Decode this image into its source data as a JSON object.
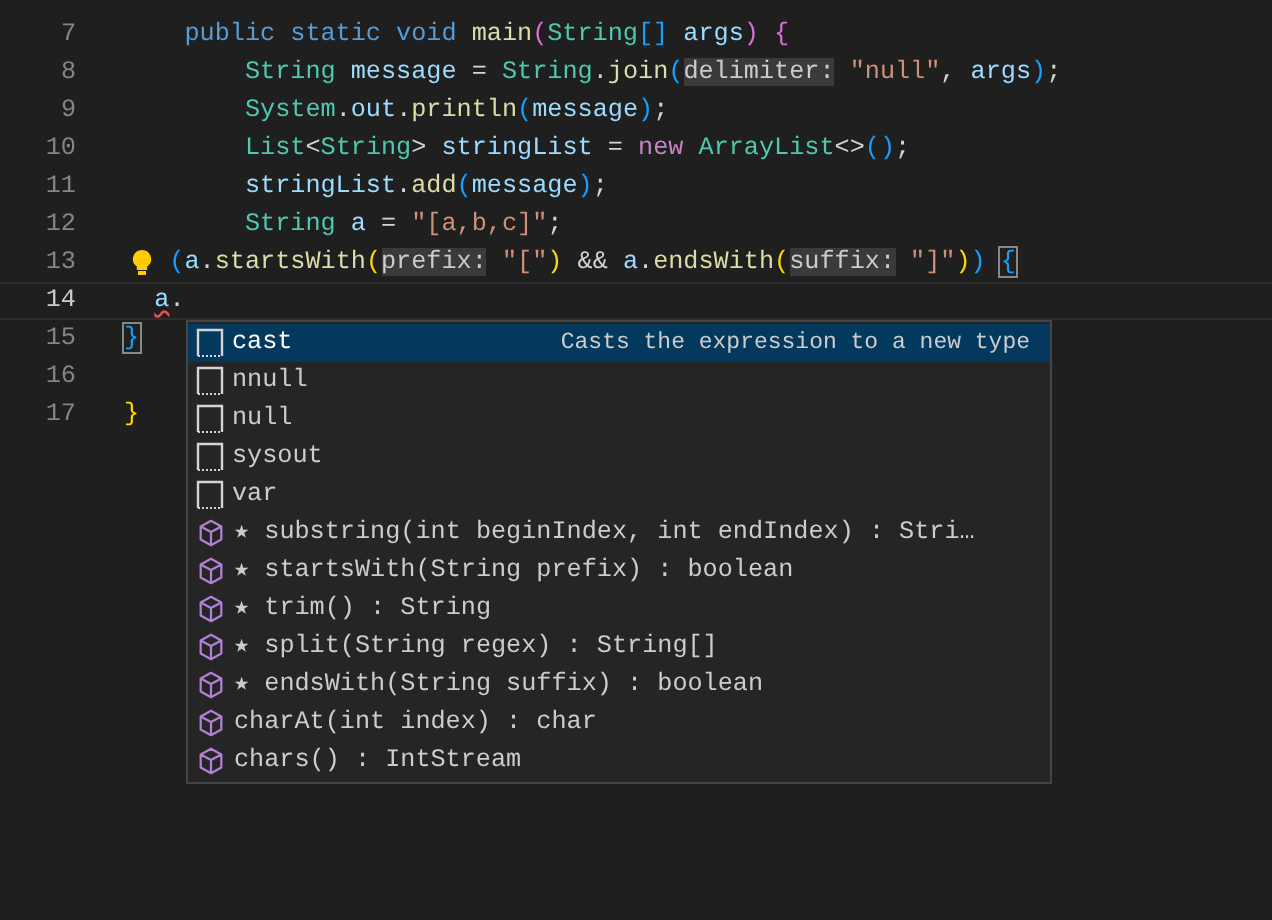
{
  "editor": {
    "lines": [
      {
        "number": "7",
        "active": false,
        "lightbulb": false,
        "tokens": [
          {
            "text": "    public static void",
            "kind": "keyword"
          },
          {
            "text": " main",
            "kind": "function"
          },
          {
            "text": "(",
            "kind": "bracket2"
          },
          {
            "text": "String",
            "kind": "type"
          },
          {
            "text": "[]",
            "kind": "bracket3"
          },
          {
            "text": " args",
            "kind": "variable"
          },
          {
            "text": ")",
            "kind": "bracket2"
          },
          {
            "text": " {",
            "kind": "bracket2"
          }
        ]
      },
      {
        "number": "8",
        "active": false,
        "lightbulb": false,
        "tokens": [
          {
            "text": "        String",
            "kind": "type"
          },
          {
            "text": " message",
            "kind": "variable"
          },
          {
            "text": " = ",
            "kind": "plain"
          },
          {
            "text": "String",
            "kind": "type"
          },
          {
            "text": ".",
            "kind": "plain"
          },
          {
            "text": "join",
            "kind": "function"
          },
          {
            "text": "(",
            "kind": "bracket3"
          },
          {
            "text": "delimiter:",
            "kind": "hint"
          },
          {
            "text": " \"null\"",
            "kind": "string"
          },
          {
            "text": ", ",
            "kind": "plain"
          },
          {
            "text": "args",
            "kind": "variable"
          },
          {
            "text": ")",
            "kind": "bracket3"
          },
          {
            "text": ";",
            "kind": "plain"
          }
        ]
      },
      {
        "number": "9",
        "active": false,
        "lightbulb": false,
        "tokens": [
          {
            "text": "        System",
            "kind": "type"
          },
          {
            "text": ".",
            "kind": "plain"
          },
          {
            "text": "out",
            "kind": "variable"
          },
          {
            "text": ".",
            "kind": "plain"
          },
          {
            "text": "println",
            "kind": "function"
          },
          {
            "text": "(",
            "kind": "bracket3"
          },
          {
            "text": "message",
            "kind": "variable"
          },
          {
            "text": ")",
            "kind": "bracket3"
          },
          {
            "text": ";",
            "kind": "plain"
          }
        ]
      },
      {
        "number": "10",
        "active": false,
        "lightbulb": false,
        "tokens": [
          {
            "text": "        List",
            "kind": "type"
          },
          {
            "text": "<",
            "kind": "plain"
          },
          {
            "text": "String",
            "kind": "type"
          },
          {
            "text": ">",
            "kind": "plain"
          },
          {
            "text": " stringList",
            "kind": "variable"
          },
          {
            "text": " = ",
            "kind": "plain"
          },
          {
            "text": "new",
            "kind": "control"
          },
          {
            "text": " ArrayList",
            "kind": "type"
          },
          {
            "text": "<>",
            "kind": "plain"
          },
          {
            "text": "()",
            "kind": "bracket3"
          },
          {
            "text": ";",
            "kind": "plain"
          }
        ]
      },
      {
        "number": "11",
        "active": false,
        "lightbulb": false,
        "tokens": [
          {
            "text": "        stringList",
            "kind": "variable"
          },
          {
            "text": ".",
            "kind": "plain"
          },
          {
            "text": "add",
            "kind": "function"
          },
          {
            "text": "(",
            "kind": "bracket3"
          },
          {
            "text": "message",
            "kind": "variable"
          },
          {
            "text": ")",
            "kind": "bracket3"
          },
          {
            "text": ";",
            "kind": "plain"
          }
        ]
      },
      {
        "number": "12",
        "active": false,
        "lightbulb": false,
        "tokens": [
          {
            "text": "        String",
            "kind": "type"
          },
          {
            "text": " a",
            "kind": "variable"
          },
          {
            "text": " = ",
            "kind": "plain"
          },
          {
            "text": "\"[a,b,c]\"",
            "kind": "string"
          },
          {
            "text": ";",
            "kind": "plain"
          }
        ]
      },
      {
        "number": "13",
        "active": false,
        "lightbulb": true,
        "tokens": [
          {
            "text": "   (",
            "kind": "bracket3"
          },
          {
            "text": "a",
            "kind": "variable"
          },
          {
            "text": ".",
            "kind": "plain"
          },
          {
            "text": "startsWith",
            "kind": "function"
          },
          {
            "text": "(",
            "kind": "bracket1"
          },
          {
            "text": "prefix:",
            "kind": "hint"
          },
          {
            "text": " \"[\"",
            "kind": "string"
          },
          {
            "text": ")",
            "kind": "bracket1"
          },
          {
            "text": " && ",
            "kind": "plain"
          },
          {
            "text": "a",
            "kind": "variable"
          },
          {
            "text": ".",
            "kind": "plain"
          },
          {
            "text": "endsWith",
            "kind": "function"
          },
          {
            "text": "(",
            "kind": "bracket1"
          },
          {
            "text": "suffix:",
            "kind": "hint"
          },
          {
            "text": " \"]\"",
            "kind": "string"
          },
          {
            "text": ")",
            "kind": "bracket1"
          },
          {
            "text": ") ",
            "kind": "bracket3"
          },
          {
            "text": "{",
            "kind": "match"
          }
        ]
      },
      {
        "number": "14",
        "active": true,
        "lightbulb": false,
        "tokens": [
          {
            "text": "  a",
            "kind": "error"
          },
          {
            "text": ".",
            "kind": "plain"
          }
        ]
      },
      {
        "number": "15",
        "active": false,
        "lightbulb": false,
        "tokens": [
          {
            "text": "}",
            "kind": "match"
          }
        ]
      },
      {
        "number": "16",
        "active": false,
        "lightbulb": false
      },
      {
        "number": "17",
        "active": false,
        "lightbulb": false,
        "tokens": [
          {
            "text": "}",
            "kind": "bracket1"
          }
        ]
      }
    ]
  },
  "suggestions": [
    {
      "kind": "snippet",
      "label": "cast",
      "detail": "Casts the expression to a new type",
      "selected": true
    },
    {
      "kind": "snippet",
      "label": "nnull",
      "selected": false
    },
    {
      "kind": "snippet",
      "label": "null",
      "selected": false
    },
    {
      "kind": "snippet",
      "label": "sysout",
      "selected": false
    },
    {
      "kind": "snippet",
      "label": "var",
      "selected": false
    },
    {
      "kind": "method",
      "label": "★ substring(int beginIndex, int endIndex) : Stri…",
      "selected": false
    },
    {
      "kind": "method",
      "label": "★ startsWith(String prefix) : boolean",
      "selected": false
    },
    {
      "kind": "method",
      "label": "★ trim() : String",
      "selected": false
    },
    {
      "kind": "method",
      "label": "★ split(String regex) : String[]",
      "selected": false
    },
    {
      "kind": "method",
      "label": "★ endsWith(String suffix) : boolean",
      "selected": false
    },
    {
      "kind": "method",
      "label": "charAt(int index) : char",
      "selected": false
    },
    {
      "kind": "method",
      "label": "chars() : IntStream",
      "selected": false
    }
  ]
}
